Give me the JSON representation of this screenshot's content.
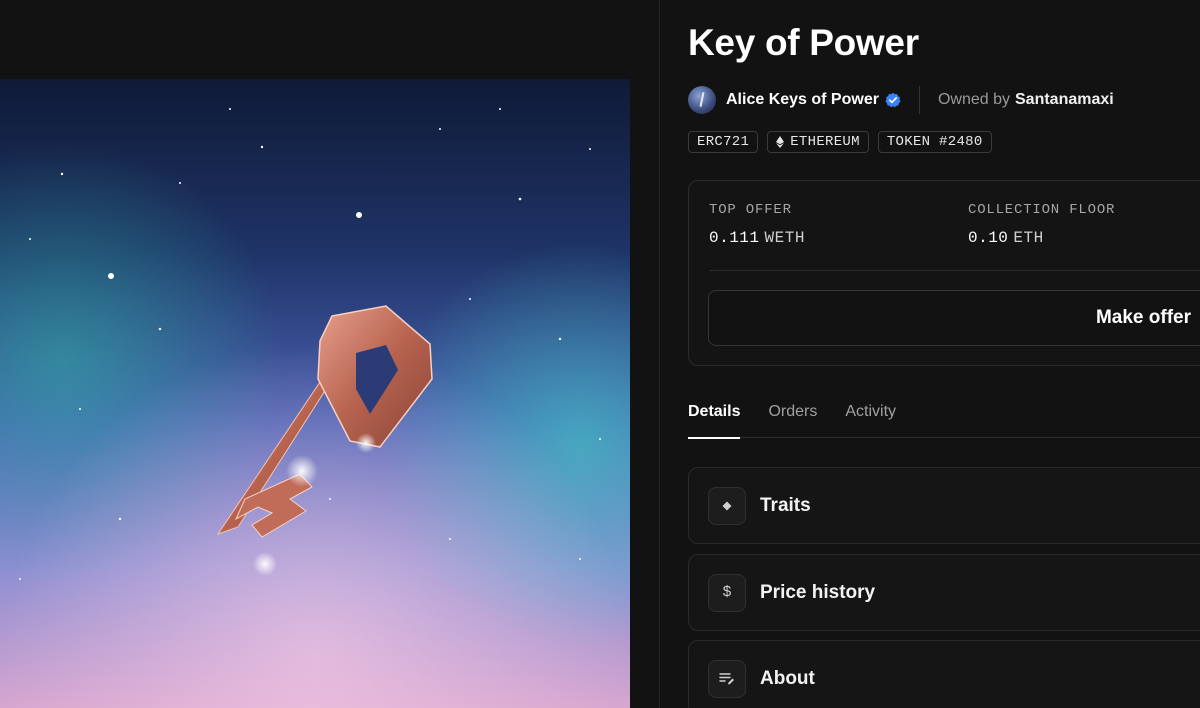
{
  "nft": {
    "title": "Key of Power",
    "collection_name": "Alice Keys of Power",
    "owned_by_label": "Owned by",
    "owner_name": "Santanamaxi",
    "tags": [
      "ERC721",
      "ETHEREUM",
      "TOKEN #2480"
    ]
  },
  "offer_card": {
    "top_offer_label": "TOP OFFER",
    "top_offer_value": "0.111",
    "top_offer_unit": "WETH",
    "floor_label": "COLLECTION FLOOR",
    "floor_value": "0.10",
    "floor_unit": "ETH",
    "make_offer_label": "Make offer"
  },
  "tabs": [
    {
      "label": "Details",
      "active": true
    },
    {
      "label": "Orders",
      "active": false
    },
    {
      "label": "Activity",
      "active": false
    }
  ],
  "sections": [
    {
      "label": "Traits",
      "icon": "diamond-icon"
    },
    {
      "label": "Price history",
      "icon": "dollar-icon"
    },
    {
      "label": "About",
      "icon": "notes-edit-icon"
    }
  ],
  "colors": {
    "background": "#111111",
    "verified_badge": "#3b82f6",
    "key_copper": "#c8735e"
  }
}
